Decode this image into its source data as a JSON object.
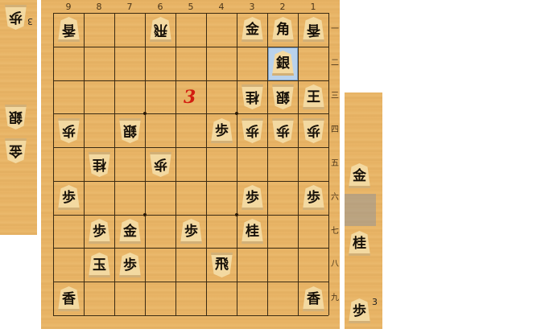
{
  "board": {
    "file_labels": [
      "9",
      "8",
      "7",
      "6",
      "5",
      "4",
      "3",
      "2",
      "1"
    ],
    "rank_labels": [
      "一",
      "二",
      "三",
      "四",
      "五",
      "六",
      "七",
      "八",
      "九"
    ],
    "pieces": [
      {
        "file": 9,
        "rank": 1,
        "owner": "sente",
        "label": "香",
        "name": "lance",
        "flip": true
      },
      {
        "file": 6,
        "rank": 1,
        "owner": "sente",
        "label": "飛",
        "name": "rook",
        "flip": true
      },
      {
        "file": 3,
        "rank": 1,
        "owner": "sente",
        "label": "金",
        "name": "gold"
      },
      {
        "file": 2,
        "rank": 1,
        "owner": "sente",
        "label": "角",
        "name": "bishop"
      },
      {
        "file": 1,
        "rank": 1,
        "owner": "sente",
        "label": "香",
        "name": "lance",
        "flip": true
      },
      {
        "file": 2,
        "rank": 2,
        "owner": "sente",
        "label": "銀",
        "name": "silver",
        "highlight": true
      },
      {
        "file": 3,
        "rank": 3,
        "owner": "gote",
        "label": "桂",
        "name": "knight"
      },
      {
        "file": 2,
        "rank": 3,
        "owner": "gote",
        "label": "銀",
        "name": "silver"
      },
      {
        "file": 1,
        "rank": 3,
        "owner": "sente",
        "label": "王",
        "name": "king"
      },
      {
        "file": 9,
        "rank": 4,
        "owner": "gote",
        "label": "歩",
        "name": "pawn"
      },
      {
        "file": 7,
        "rank": 4,
        "owner": "gote",
        "label": "銀",
        "name": "silver"
      },
      {
        "file": 4,
        "rank": 4,
        "owner": "sente",
        "label": "歩",
        "name": "pawn"
      },
      {
        "file": 3,
        "rank": 4,
        "owner": "gote",
        "label": "歩",
        "name": "pawn"
      },
      {
        "file": 2,
        "rank": 4,
        "owner": "gote",
        "label": "歩",
        "name": "pawn"
      },
      {
        "file": 1,
        "rank": 4,
        "owner": "gote",
        "label": "歩",
        "name": "pawn"
      },
      {
        "file": 8,
        "rank": 5,
        "owner": "gote",
        "label": "桂",
        "name": "knight"
      },
      {
        "file": 6,
        "rank": 5,
        "owner": "gote",
        "label": "歩",
        "name": "pawn"
      },
      {
        "file": 9,
        "rank": 6,
        "owner": "sente",
        "label": "歩",
        "name": "pawn"
      },
      {
        "file": 3,
        "rank": 6,
        "owner": "sente",
        "label": "歩",
        "name": "pawn"
      },
      {
        "file": 1,
        "rank": 6,
        "owner": "sente",
        "label": "歩",
        "name": "pawn"
      },
      {
        "file": 8,
        "rank": 7,
        "owner": "sente",
        "label": "歩",
        "name": "pawn"
      },
      {
        "file": 7,
        "rank": 7,
        "owner": "sente",
        "label": "金",
        "name": "gold"
      },
      {
        "file": 5,
        "rank": 7,
        "owner": "sente",
        "label": "歩",
        "name": "pawn"
      },
      {
        "file": 3,
        "rank": 7,
        "owner": "sente",
        "label": "桂",
        "name": "knight"
      },
      {
        "file": 8,
        "rank": 8,
        "owner": "sente",
        "label": "玉",
        "name": "king"
      },
      {
        "file": 7,
        "rank": 8,
        "owner": "sente",
        "label": "歩",
        "name": "pawn"
      },
      {
        "file": 4,
        "rank": 8,
        "owner": "gote",
        "label": "飛",
        "name": "rook",
        "flip": true
      },
      {
        "file": 9,
        "rank": 9,
        "owner": "sente",
        "label": "香",
        "name": "lance"
      },
      {
        "file": 1,
        "rank": 9,
        "owner": "sente",
        "label": "香",
        "name": "lance"
      }
    ],
    "annotation": {
      "file": 5,
      "rank": 3,
      "text": "3"
    }
  },
  "gote_hand": {
    "pieces": [
      {
        "label": "歩",
        "count": "3"
      },
      {
        "label": "銀",
        "count": ""
      },
      {
        "label": "金",
        "count": ""
      }
    ]
  },
  "sente_hand": {
    "pieces": [
      {
        "label": "金",
        "count": ""
      },
      {
        "label": "桂",
        "count": ""
      },
      {
        "label": "歩",
        "count": "3"
      }
    ]
  },
  "colors": {
    "highlight": "#b9d2ec",
    "grid": "#3a2a12",
    "annotation": "#d21d10"
  }
}
